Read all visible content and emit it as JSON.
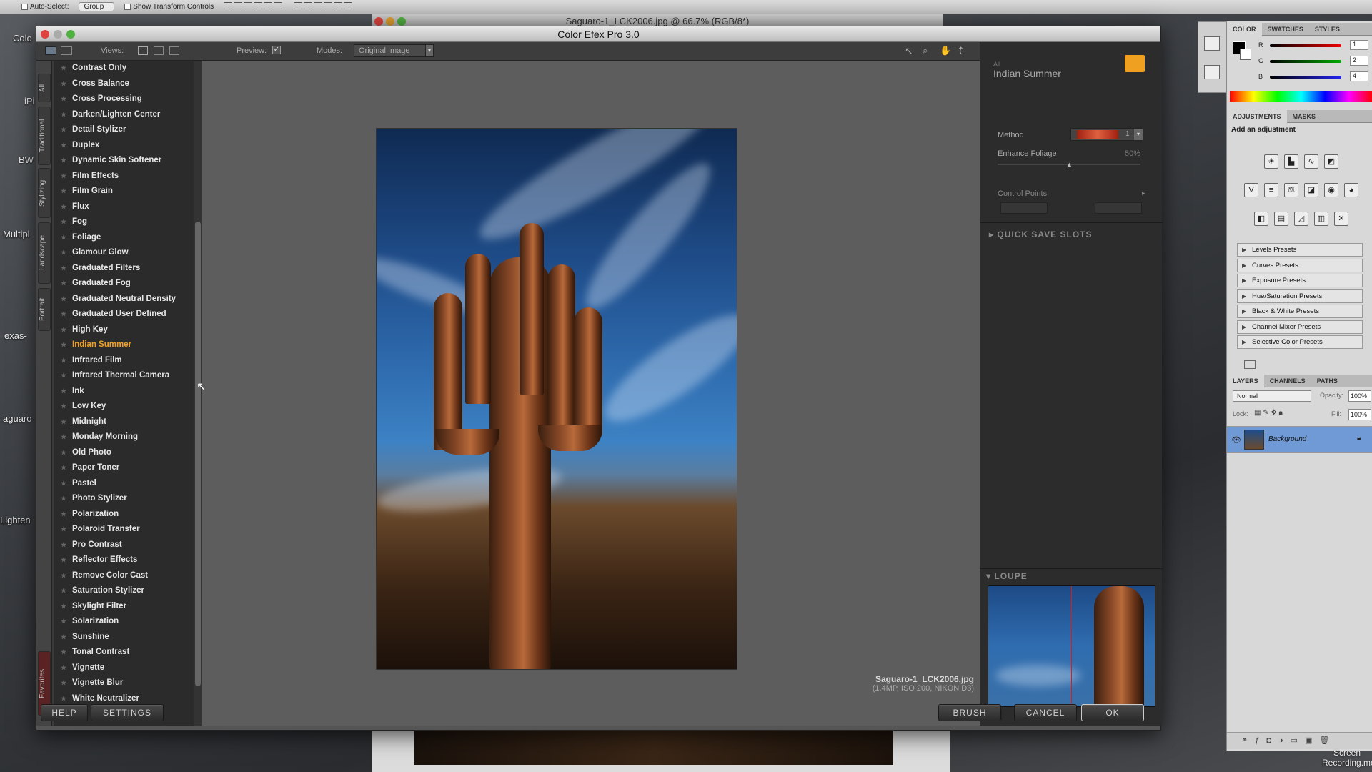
{
  "photoshop": {
    "options_bar": {
      "auto_select": "Auto-Select:",
      "group": "Group",
      "show_transform": "Show Transform Controls"
    },
    "doc_title": "Saguaro-1_LCK2006.jpg @ 66.7% (RGB/8*)",
    "desktop_labels": [
      "Colo",
      "iPi",
      "BW",
      "Multipl",
      "exas-",
      "aguaro",
      "Lighten"
    ],
    "color_panel": {
      "tabs": [
        "COLOR",
        "SWATCHES",
        "STYLES"
      ],
      "r_label": "R",
      "g_label": "G",
      "b_label": "B",
      "r_value": "1",
      "g_value": "2",
      "b_value": "4"
    },
    "adjustments": {
      "tabs": [
        "ADJUSTMENTS",
        "MASKS"
      ],
      "heading": "Add an adjustment",
      "presets": [
        "Levels Presets",
        "Curves Presets",
        "Exposure Presets",
        "Hue/Saturation Presets",
        "Black & White Presets",
        "Channel Mixer Presets",
        "Selective Color Presets"
      ]
    },
    "layers": {
      "tabs": [
        "LAYERS",
        "CHANNELS",
        "PATHS"
      ],
      "blend_mode": "Normal",
      "opacity_label": "Opacity:",
      "opacity_value": "100%",
      "lock_label": "Lock:",
      "fill_label": "Fill:",
      "fill_value": "100%",
      "layer_name": "Background"
    },
    "screen_recording": "Screen Recording.mov"
  },
  "cefex": {
    "title": "Color Efex Pro 3.0",
    "toolbar": {
      "views_label": "Views:",
      "preview_label": "Preview:",
      "modes_label": "Modes:",
      "mode_value": "Original Image"
    },
    "vertical_tabs": [
      "All",
      "Traditional",
      "Stylizing",
      "Landscape",
      "Portrait",
      "Favorites"
    ],
    "filters": [
      "Contrast Only",
      "Cross Balance",
      "Cross Processing",
      "Darken/Lighten Center",
      "Detail Stylizer",
      "Duplex",
      "Dynamic Skin Softener",
      "Film Effects",
      "Film Grain",
      "Flux",
      "Fog",
      "Foliage",
      "Glamour Glow",
      "Graduated Filters",
      "Graduated Fog",
      "Graduated Neutral Density",
      "Graduated User Defined",
      "High Key",
      "Indian Summer",
      "Infrared Film",
      "Infrared Thermal Camera",
      "Ink",
      "Low Key",
      "Midnight",
      "Monday Morning",
      "Old Photo",
      "Paper Toner",
      "Pastel",
      "Photo Stylizer",
      "Polarization",
      "Polaroid Transfer",
      "Pro Contrast",
      "Reflector Effects",
      "Remove Color Cast",
      "Saturation Stylizer",
      "Skylight Filter",
      "Solarization",
      "Sunshine",
      "Tonal Contrast",
      "Vignette",
      "Vignette Blur",
      "White Neutralizer"
    ],
    "selected_filter": "Indian Summer",
    "photo": {
      "filename": "Saguaro-1_LCK2006.jpg",
      "info": "(1.4MP, ISO 200, NIKON D3)"
    },
    "right_panel": {
      "breadcrumb": "All",
      "filter_name": "Indian Summer",
      "method_label": "Method",
      "method_value": "1",
      "enhance_label": "Enhance Foliage",
      "enhance_value": "50%",
      "enhance_level": 0.5,
      "control_points_label": "Control Points",
      "quick_save_label": "QUICK SAVE SLOTS",
      "loupe_label": "LOUPE"
    },
    "buttons": {
      "help": "HELP",
      "settings": "SETTINGS",
      "brush": "BRUSH",
      "cancel": "CANCEL",
      "ok": "OK"
    }
  },
  "colors": {
    "selected_filter": "#f0a020",
    "layer_highlight": "#6f9ad6"
  }
}
